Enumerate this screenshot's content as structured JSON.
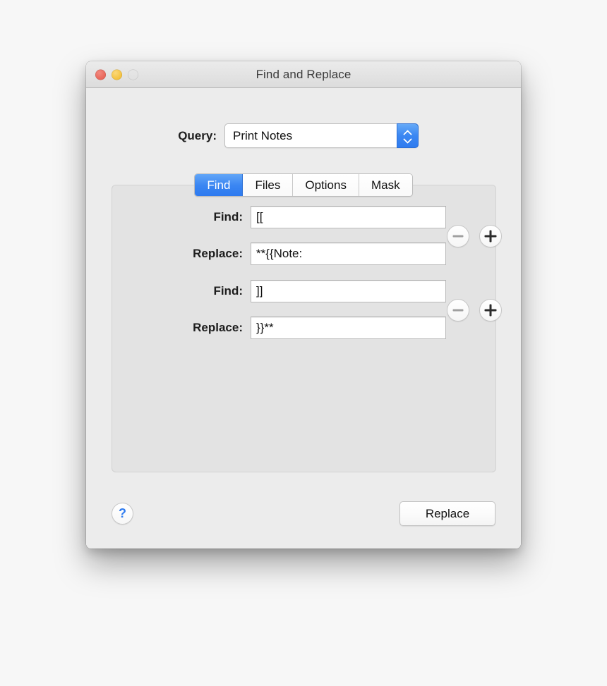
{
  "window": {
    "title": "Find and Replace",
    "traffic_lights": [
      {
        "name": "close",
        "color": "#e9685c"
      },
      {
        "name": "minimize",
        "color": "#f4c343"
      },
      {
        "name": "zoom",
        "color": "#5fc54e"
      }
    ]
  },
  "query": {
    "label": "Query:",
    "value": "Print Notes",
    "stepper_icon": "up-down-chevron-icon"
  },
  "tabs": [
    {
      "label": "Find",
      "selected": true
    },
    {
      "label": "Files",
      "selected": false
    },
    {
      "label": "Options",
      "selected": false
    },
    {
      "label": "Mask",
      "selected": false
    }
  ],
  "find_pane": {
    "rows": [
      {
        "find_label": "Find:",
        "find_value": "[[",
        "replace_label": "Replace:",
        "replace_value": "**{{Note:"
      },
      {
        "find_label": "Find:",
        "find_value": "]]",
        "replace_label": "Replace:",
        "replace_value": "}}**"
      }
    ],
    "remove_icon": "minus-icon",
    "add_icon": "plus-icon"
  },
  "footer": {
    "help_label": "?",
    "replace_label": "Replace"
  },
  "colors": {
    "accent_blue": "#3a86f2",
    "window_bg": "#ececec",
    "pane_bg": "#e3e3e3",
    "desktop_bg": "#f7f7f7"
  }
}
